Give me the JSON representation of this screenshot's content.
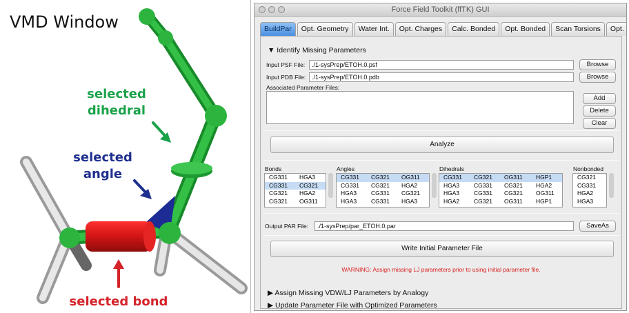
{
  "vmd_panel": {
    "title": "VMD Window",
    "label_dihedral_line1": "selected",
    "label_dihedral_line2": "dihedral",
    "label_angle_line1": "selected",
    "label_angle_line2": "angle",
    "label_bond": "selected bond"
  },
  "window": {
    "title": "Force Field Toolkit (ffTK) GUI"
  },
  "tabs": [
    {
      "label": "BuildPar",
      "active": true
    },
    {
      "label": "Opt. Geometry"
    },
    {
      "label": "Water Int."
    },
    {
      "label": "Opt. Charges"
    },
    {
      "label": "Calc. Bonded"
    },
    {
      "label": "Opt. Bonded"
    },
    {
      "label": "Scan Torsions"
    },
    {
      "label": "Opt. Torsions"
    }
  ],
  "identify": {
    "header": "▼ Identify Missing Parameters",
    "psf_label": "Input PSF File:",
    "psf_value": "./1-sysPrep/ETOH.0.psf",
    "pdb_label": "Input PDB File:",
    "pdb_value": "./1-sysPrep/ETOH.0.pdb",
    "browse": "Browse",
    "assoc_label": "Associated Parameter Files:",
    "add": "Add",
    "delete": "Delete",
    "clear": "Clear",
    "analyze": "Analyze"
  },
  "lists": {
    "bonds_label": "Bonds",
    "angles_label": "Angles",
    "dihedrals_label": "Dihedrals",
    "nonbonded_label": "Nonbonded",
    "bonds": [
      [
        "CG331",
        "HGA3"
      ],
      [
        "CG331",
        "CG321"
      ],
      [
        "CG321",
        "HGA2"
      ],
      [
        "CG321",
        "OG311"
      ]
    ],
    "angles": [
      [
        "CG331",
        "CG321",
        "OG311"
      ],
      [
        "CG331",
        "CG321",
        "HGA2"
      ],
      [
        "HGA3",
        "CG331",
        "CG321"
      ],
      [
        "HGA3",
        "CG331",
        "HGA3"
      ]
    ],
    "dihedrals": [
      [
        "CG331",
        "CG321",
        "OG311",
        "HGP1"
      ],
      [
        "HGA3",
        "CG331",
        "CG321",
        "HGA2"
      ],
      [
        "HGA3",
        "CG331",
        "CG321",
        "OG311"
      ],
      [
        "HGA2",
        "CG321",
        "OG311",
        "HGP1"
      ]
    ],
    "nonbonded": [
      "CG321",
      "CG331",
      "HGA2",
      "HGA3"
    ]
  },
  "output": {
    "par_label": "Output PAR File:",
    "par_value": "./1-sysPrep/par_ETOH.0.par",
    "saveas": "SaveAs",
    "write": "Write Initial Parameter File",
    "warning": "WARNING: Assign missing LJ parameters prior to using initial parameter file."
  },
  "collapsed": {
    "assign": "▶ Assign Missing VDW/LJ Parameters by Analogy",
    "update": "▶ Update Parameter File with Optimized Parameters"
  },
  "colors": {
    "green": "#1aa24a",
    "blue": "#1f2f8f",
    "red": "#d5232a",
    "tab_active": "#4a8fe0",
    "warning": "#d81e1e",
    "list_selection": "#c6dbf4"
  }
}
